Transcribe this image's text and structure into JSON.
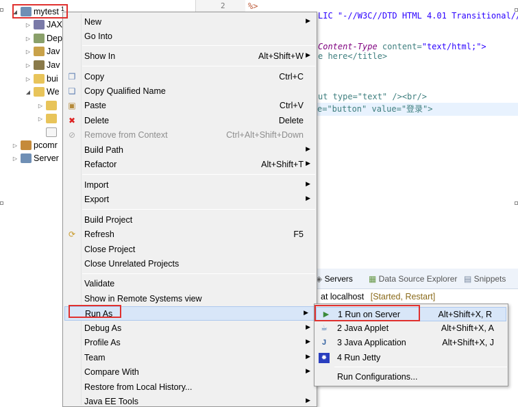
{
  "tree": {
    "root": {
      "label": "mytest",
      "badge": "1"
    },
    "children": [
      "JAX",
      "Dep",
      "Jav",
      "Jav",
      "bui",
      "We"
    ],
    "others": [
      "pcomr",
      "Server"
    ]
  },
  "editor": {
    "line_number": "2",
    "lines": [
      {
        "pct": "%>"
      },
      {
        "text": "LIC \"-//W3C//DTD HTML 4.01 Transitional//EN"
      },
      {
        "attr": "Content-Type",
        "rest": " content=",
        "str": "\"text/html;\">"
      },
      {
        "text": "e here</title>"
      },
      {
        "text": "ut type=\"text\" /><br/>"
      },
      {
        "text": "e=\"button\" value=\"登录\">"
      }
    ]
  },
  "servers_panel": {
    "tabs": [
      "Servers",
      "Data Source Explorer",
      "Snippets"
    ],
    "row_text": "at localhost",
    "row_status": "[Started, Restart]"
  },
  "context_menu": {
    "items": [
      {
        "label": "New",
        "shortcut": "",
        "submenu": true
      },
      {
        "label": "Go Into",
        "shortcut": ""
      },
      {
        "label": "Show In",
        "shortcut": "Alt+Shift+W",
        "submenu": true
      },
      {
        "label": "Copy",
        "shortcut": "Ctrl+C",
        "icon": "copy-icon"
      },
      {
        "label": "Copy Qualified Name",
        "shortcut": "",
        "icon": "copy-qualified-icon"
      },
      {
        "label": "Paste",
        "shortcut": "Ctrl+V",
        "icon": "paste-icon"
      },
      {
        "label": "Delete",
        "shortcut": "Delete",
        "icon": "delete-icon"
      },
      {
        "label": "Remove from Context",
        "shortcut": "Ctrl+Alt+Shift+Down",
        "disabled": true,
        "icon": "remove-context-icon"
      },
      {
        "label": "Build Path",
        "shortcut": "",
        "submenu": true
      },
      {
        "label": "Refactor",
        "shortcut": "Alt+Shift+T",
        "submenu": true
      },
      {
        "label": "Import",
        "shortcut": "",
        "submenu": true
      },
      {
        "label": "Export",
        "shortcut": "",
        "submenu": true
      },
      {
        "label": "Build Project",
        "shortcut": ""
      },
      {
        "label": "Refresh",
        "shortcut": "F5",
        "icon": "refresh-icon"
      },
      {
        "label": "Close Project",
        "shortcut": ""
      },
      {
        "label": "Close Unrelated Projects",
        "shortcut": ""
      },
      {
        "label": "Validate",
        "shortcut": ""
      },
      {
        "label": "Show in Remote Systems view",
        "shortcut": ""
      },
      {
        "label": "Run As",
        "shortcut": "",
        "submenu": true,
        "active": true
      },
      {
        "label": "Debug As",
        "shortcut": "",
        "submenu": true
      },
      {
        "label": "Profile As",
        "shortcut": "",
        "submenu": true
      },
      {
        "label": "Team",
        "shortcut": "",
        "submenu": true
      },
      {
        "label": "Compare With",
        "shortcut": "",
        "submenu": true
      },
      {
        "label": "Restore from Local History...",
        "shortcut": ""
      },
      {
        "label": "Java EE Tools",
        "shortcut": "",
        "submenu": true
      }
    ]
  },
  "run_as_submenu": {
    "items": [
      {
        "label": "1 Run on Server",
        "shortcut": "Alt+Shift+X, R",
        "icon": "run-on-server-icon",
        "active": true
      },
      {
        "label": "2 Java Applet",
        "shortcut": "Alt+Shift+X, A",
        "icon": "java-applet-icon"
      },
      {
        "label": "3 Java Application",
        "shortcut": "Alt+Shift+X, J",
        "icon": "java-application-icon"
      },
      {
        "label": "4 Run Jetty",
        "shortcut": "",
        "icon": "jetty-icon"
      },
      {
        "label": "Run Configurations...",
        "shortcut": ""
      }
    ]
  },
  "colors": {
    "highlight": "#e0302e",
    "menu_bg": "#f0f0f0",
    "hover_bg": "#d8e6f8"
  }
}
